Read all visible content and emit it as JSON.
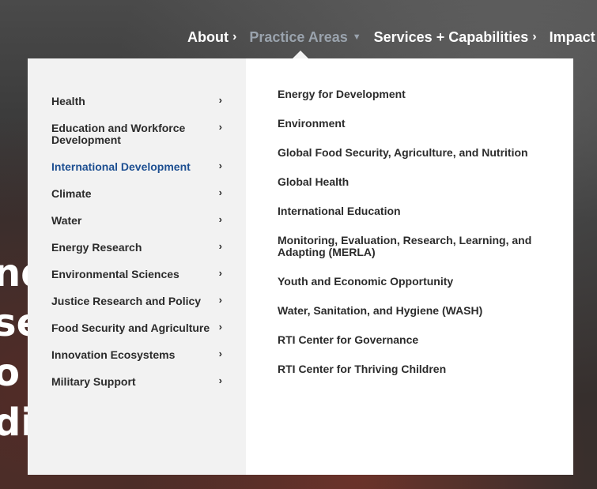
{
  "nav": {
    "about": "About",
    "practice_areas": "Practice Areas",
    "services": "Services + Capabilities",
    "impact": "Impact"
  },
  "hero": {
    "lines": [
      "nd",
      "se",
      "o i",
      "dit"
    ]
  },
  "categories": [
    "Health",
    "Education and Workforce Development",
    "International Development",
    "Climate",
    "Water",
    "Energy Research",
    "Environmental Sciences",
    "Justice Research and Policy",
    "Food Security and Agriculture",
    "Innovation Ecosystems",
    "Military Support"
  ],
  "selected_category": "International Development",
  "subitems": [
    "Energy for Development",
    "Environment",
    "Global Food Security, Agriculture, and Nutrition",
    "Global Health",
    "International Education",
    "Monitoring, Evaluation, Research, Learning, and Adapting (MERLA)",
    "Youth and Economic Opportunity",
    "Water, Sanitation, and Hygiene (WASH)",
    "RTI Center for Governance",
    "RTI Center for Thriving Children"
  ],
  "colors": {
    "accent": "#1d4f91",
    "nav_active": "#9aa3ad",
    "left_panel": "#f2f2f2"
  }
}
